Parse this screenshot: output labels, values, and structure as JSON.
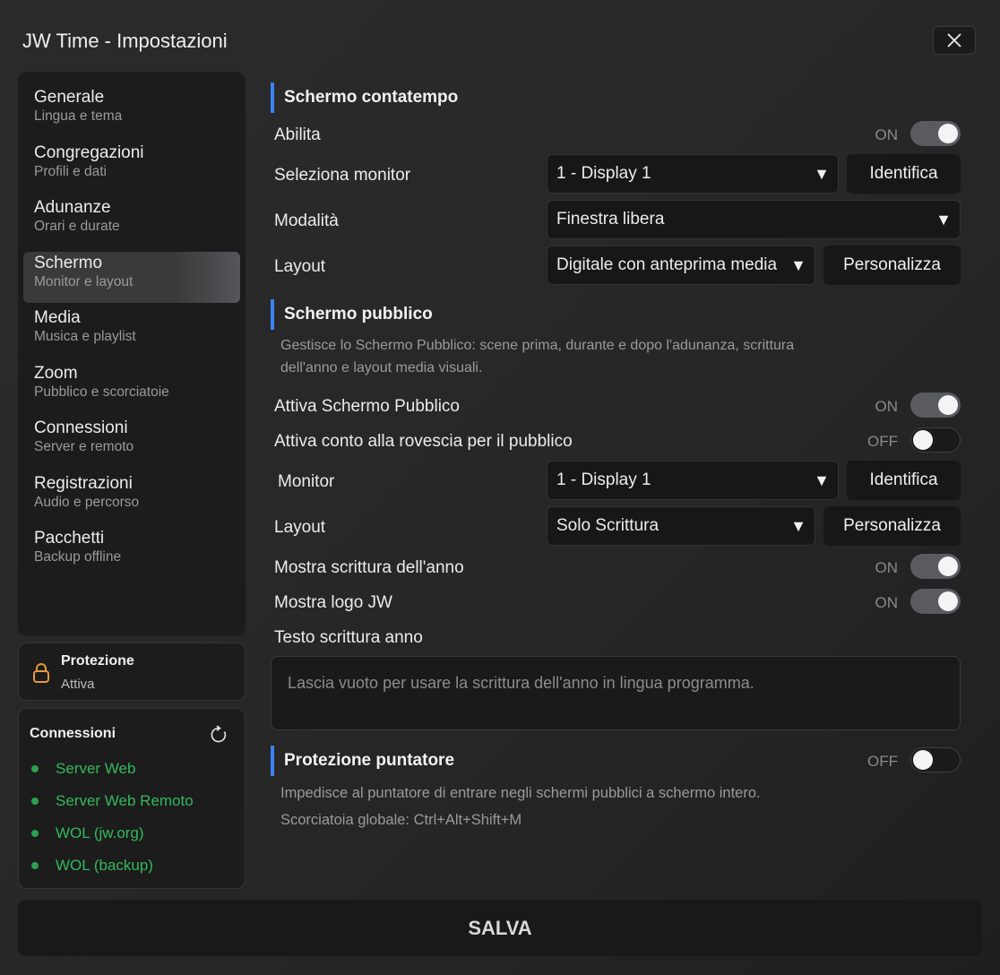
{
  "window": {
    "title": "JW Time - Impostazioni"
  },
  "sidebar": {
    "items": [
      {
        "label": "Generale",
        "sub": "Lingua e tema"
      },
      {
        "label": "Congregazioni",
        "sub": "Profili e dati"
      },
      {
        "label": "Adunanze",
        "sub": "Orari e durate"
      },
      {
        "label": "Schermo",
        "sub": "Monitor e layout"
      },
      {
        "label": "Media",
        "sub": "Musica e playlist"
      },
      {
        "label": "Zoom",
        "sub": "Pubblico e scorciatoie"
      },
      {
        "label": "Connessioni",
        "sub": "Server e remoto"
      },
      {
        "label": "Registrazioni",
        "sub": "Audio e percorso"
      },
      {
        "label": "Pacchetti",
        "sub": "Backup offline"
      }
    ]
  },
  "protection": {
    "title": "Protezione",
    "status": "Attiva"
  },
  "connections": {
    "title": "Connessioni",
    "items": [
      "Server Web",
      "Server Web Remoto",
      "WOL (jw.org)",
      "WOL (backup)"
    ]
  },
  "timer_screen": {
    "title": "Schermo contatempo",
    "enable_label": "Abilita",
    "enable_state": "ON",
    "monitor_label": "Seleziona monitor",
    "monitor_value": "1 - Display 1",
    "identify_label": "Identifica",
    "mode_label": "Modalità",
    "mode_value": "Finestra libera",
    "layout_label": "Layout",
    "layout_value": "Digitale con anteprima media",
    "customize_label": "Personalizza"
  },
  "public_screen": {
    "title": "Schermo pubblico",
    "desc_line1": "Gestisce lo Schermo Pubblico: scene prima, durante e dopo l'adunanza, scrittura",
    "desc_line2": "dell'anno e layout media visuali.",
    "activate_label": "Attiva Schermo Pubblico",
    "activate_state": "ON",
    "countdown_label": "Attiva conto alla rovescia per il pubblico",
    "countdown_state": "OFF",
    "monitor_label": "Monitor",
    "monitor_value": "1 - Display 1",
    "identify_label": "Identifica",
    "layout_label": "Layout",
    "layout_value": "Solo Scrittura",
    "customize_label": "Personalizza",
    "yeartext_label": "Mostra scrittura dell'anno",
    "yeartext_state": "ON",
    "logo_label": "Mostra logo JW",
    "logo_state": "ON",
    "text_label": "Testo scrittura anno",
    "text_placeholder": "Lascia vuoto per usare la scrittura dell'anno in lingua programma."
  },
  "pointer_protection": {
    "title": "Protezione puntatore",
    "state": "OFF",
    "desc": "Impedisce al puntatore di entrare negli schermi pubblici a schermo intero.",
    "shortcut": "Scorciatoia globale: Ctrl+Alt+Shift+M"
  },
  "footer": {
    "save_label": "SALVA"
  },
  "colors": {
    "accent": "#3b82f6",
    "online": "#33b85c",
    "lock": "#e69a3c"
  },
  "icons": {
    "close": "close-icon",
    "lock": "lock-icon",
    "refresh": "refresh-icon",
    "dropdown": "triangle-down-icon"
  }
}
